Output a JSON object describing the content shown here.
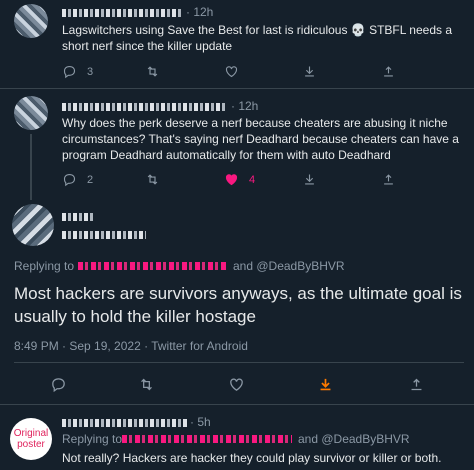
{
  "tweets": [
    {
      "time": "· 12h",
      "text": "Lagswitchers using Save the Best for last is ridiculous 💀 STBFL needs a short nerf since the killer update",
      "reply_count": "3",
      "like_count": ""
    },
    {
      "time": "· 12h",
      "text": "Why does the perk deserve a nerf because cheaters are abusing it niche circumstances? That's saying nerf Deadhard because cheaters can have a program Deadhard automatically for them with auto Deadhard",
      "reply_count": "2",
      "like_count": "4"
    }
  ],
  "main_tweet": {
    "replying_to": "Replying to",
    "and_mention": "and @DeadByBHVR",
    "text": "Most hackers are survivors anyways, as the ultimate goal is usually to hold the killer hostage",
    "timestamp": "8:49 PM · Sep 19, 2022 · Twitter for Android"
  },
  "reply": {
    "badge": "Original poster",
    "time": "· 5h",
    "replying_to": "Replying to",
    "and_mention": "and @DeadByBHVR",
    "text": "Not really? Hackers are hacker they could play survivor or killer or both."
  },
  "icons": [
    "reply-icon",
    "retweet-icon",
    "like-icon",
    "share-icon",
    "analytics-icon"
  ],
  "colors": {
    "background": "#15202b",
    "link": "#1d9bf0",
    "like": "#f91880",
    "share_active": "#ff7a00"
  }
}
